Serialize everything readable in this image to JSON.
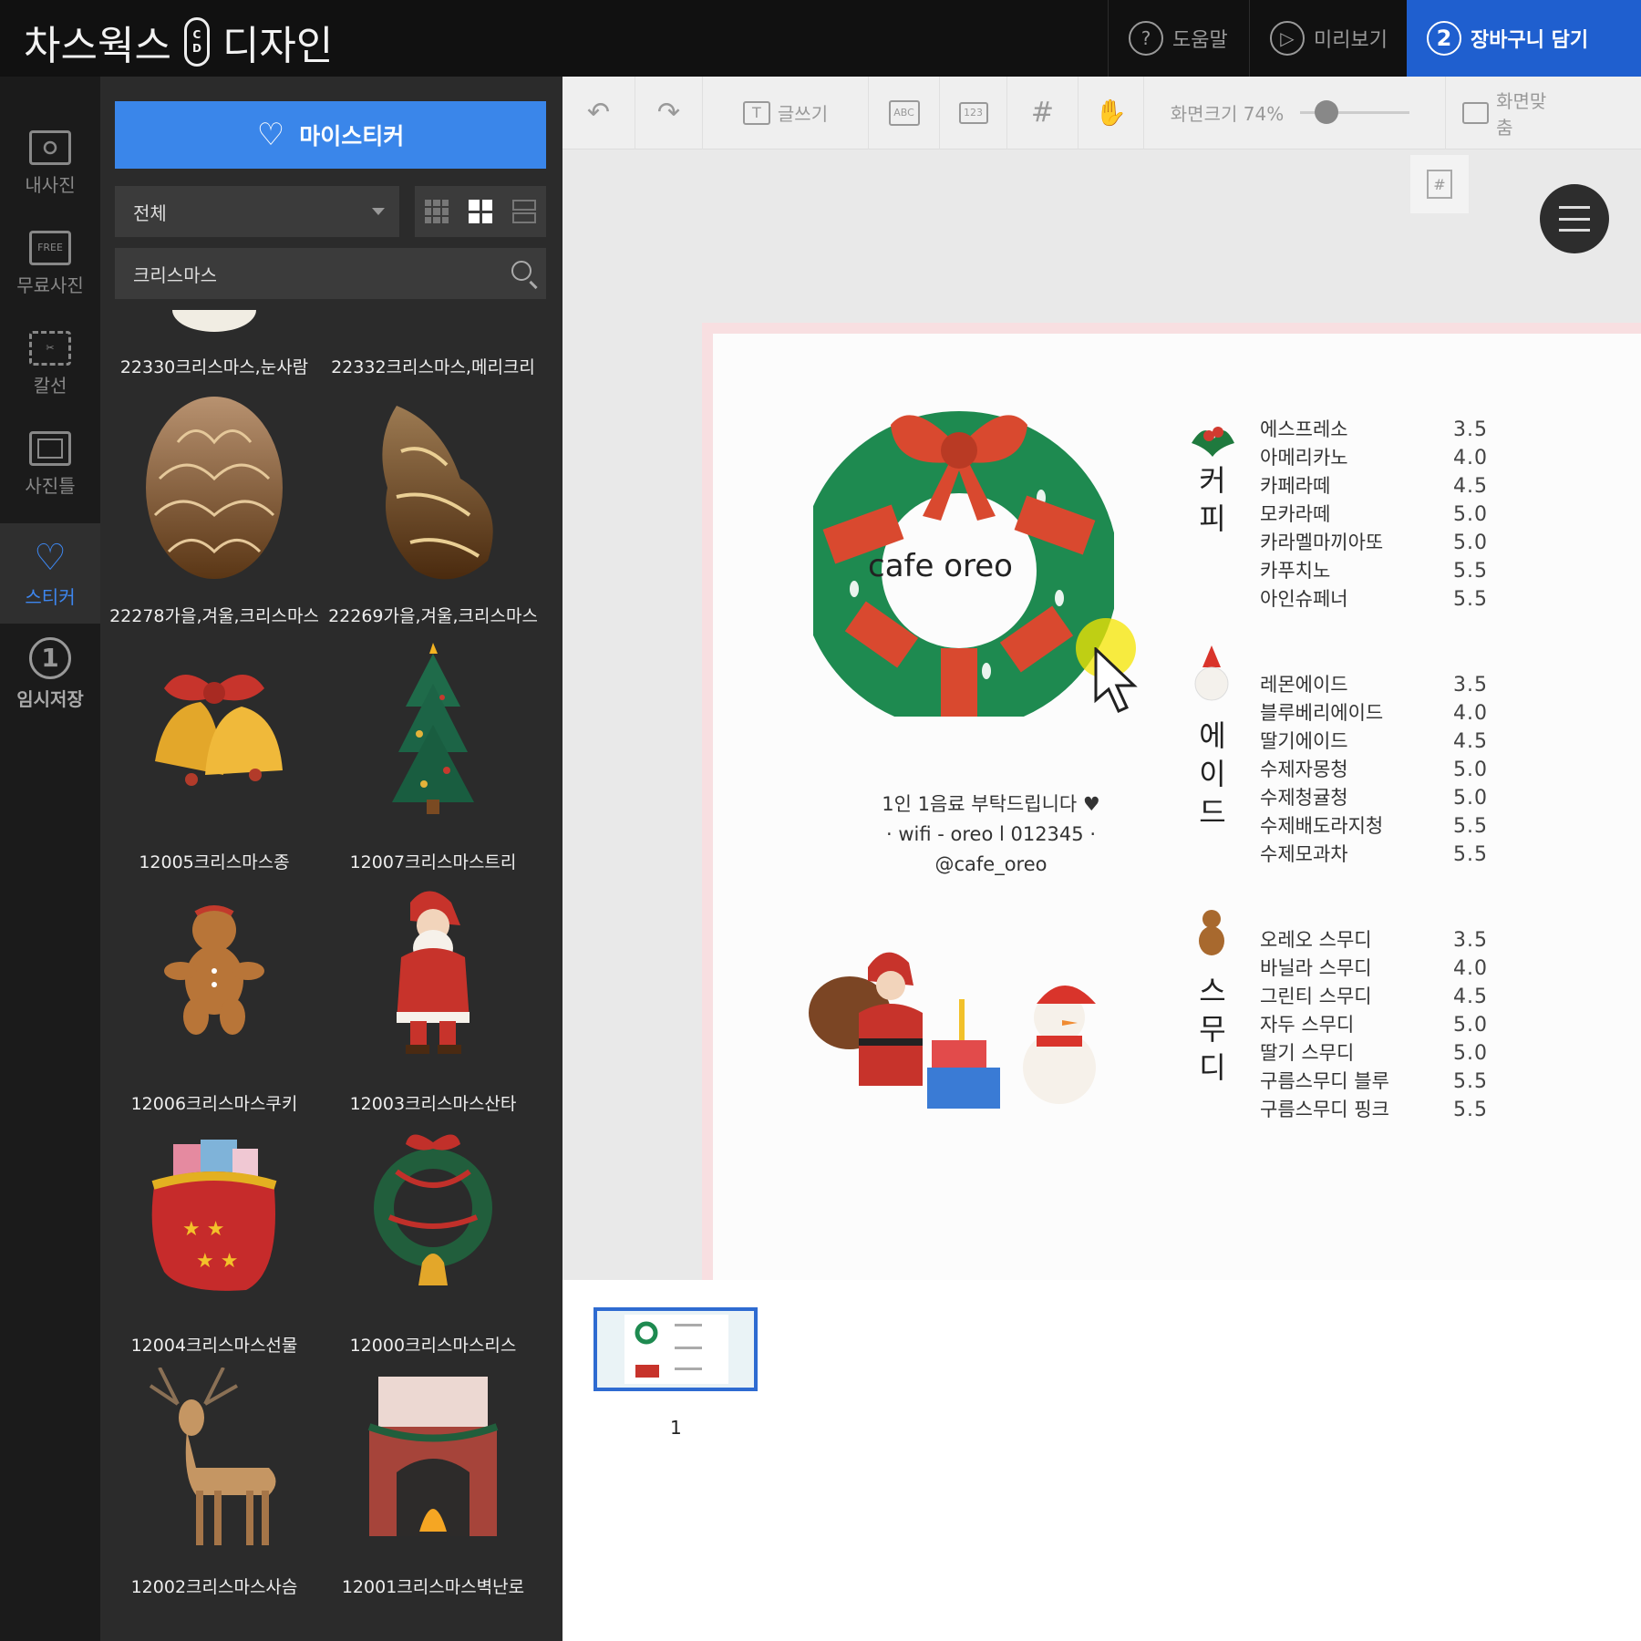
{
  "header": {
    "logo_left": "차스웍스",
    "logo_cap_top": "C",
    "logo_cap_bottom": "D",
    "logo_right": "디자인",
    "help": {
      "icon": "?",
      "label": "도움말"
    },
    "preview": {
      "icon": "▷",
      "label": "미리보기"
    },
    "cart": {
      "icon": "2",
      "label": "장바구니 담기"
    }
  },
  "nav": [
    {
      "label": "내사진",
      "icon": "camera-icon"
    },
    {
      "label": "무료사진",
      "icon_text": "FREE"
    },
    {
      "label": "칼선",
      "icon": "scissors-icon"
    },
    {
      "label": "사진틀",
      "icon": "frame-icon"
    },
    {
      "label": "스티커",
      "icon": "heart-icon"
    },
    {
      "label": "임시저장",
      "icon_text": "1"
    }
  ],
  "panel": {
    "my_sticker": "마이스티커",
    "filter_value": "전체",
    "search_value": "크리스마스",
    "items": [
      {
        "label": "22330크리스마스,눈사람"
      },
      {
        "label": "22332크리스마스,메리크리"
      },
      {
        "label": "22278가을,겨울,크리스마스"
      },
      {
        "label": "22269가을,겨울,크리스마스"
      },
      {
        "label": "12005크리스마스종"
      },
      {
        "label": "12007크리스마스트리"
      },
      {
        "label": "12006크리스마스쿠키"
      },
      {
        "label": "12003크리스마스산타"
      },
      {
        "label": "12004크리스마스선물"
      },
      {
        "label": "12000크리스마스리스"
      },
      {
        "label": "12002크리스마스사슴"
      },
      {
        "label": "12001크리스마스벽난로"
      }
    ]
  },
  "toolbar": {
    "text_tool": "글쓰기",
    "abc": "ABC",
    "num": "123",
    "zoom_label": "화면크기 74%",
    "zoom_level": 0.74,
    "fit": "화면맞춤",
    "hash": "#"
  },
  "design": {
    "title": "cafe oreo",
    "notice": [
      "1인 1음료 부탁드립니다 ♥",
      "· wifi - oreo l 012345 ·",
      "@cafe_oreo"
    ],
    "sections": [
      {
        "category": [
          "커",
          "피"
        ],
        "items": [
          [
            "에스프레소",
            "3.5"
          ],
          [
            "아메리카노",
            "4.0"
          ],
          [
            "카페라떼",
            "4.5"
          ],
          [
            "모카라떼",
            "5.0"
          ],
          [
            "카라멜마끼아또",
            "5.0"
          ],
          [
            "카푸치노",
            "5.5"
          ],
          [
            "아인슈페너",
            "5.5"
          ]
        ]
      },
      {
        "category": [
          "에",
          "이",
          "드"
        ],
        "items": [
          [
            "레몬에이드",
            "3.5"
          ],
          [
            "블루베리에이드",
            "4.0"
          ],
          [
            "딸기에이드",
            "4.5"
          ],
          [
            "수제자몽청",
            "5.0"
          ],
          [
            "수제청귤청",
            "5.0"
          ],
          [
            "수제배도라지청",
            "5.5"
          ],
          [
            "수제모과차",
            "5.5"
          ]
        ]
      },
      {
        "category": [
          "스",
          "무",
          "디"
        ],
        "items": [
          [
            "오레오 스무디",
            "3.5"
          ],
          [
            "바닐라 스무디",
            "4.0"
          ],
          [
            "그린티 스무디",
            "4.5"
          ],
          [
            "자두 스무디",
            "5.0"
          ],
          [
            "딸기 스무디",
            "5.0"
          ],
          [
            "구름스무디 블루",
            "5.5"
          ],
          [
            "구름스무디 핑크",
            "5.5"
          ]
        ]
      }
    ]
  },
  "pages": {
    "current": "1"
  },
  "colors": {
    "accent": "#3a86ea",
    "cart": "#1f5fcf",
    "wreath": "#1e8a50",
    "ribbon": "#d9492f"
  }
}
